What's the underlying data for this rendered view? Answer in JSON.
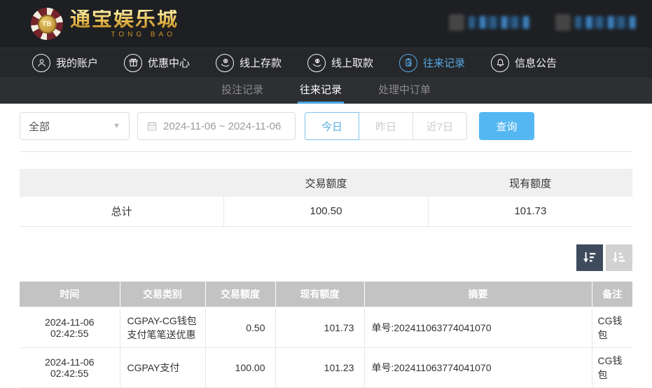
{
  "brand": {
    "logo_monogram": "TB",
    "name_cn": "通宝娱乐城",
    "name_en": "TONG BAO"
  },
  "nav": {
    "items": [
      {
        "label": "我的账户",
        "icon": "user-icon",
        "active": false
      },
      {
        "label": "优惠中心",
        "icon": "gift-icon",
        "active": false
      },
      {
        "label": "线上存款",
        "icon": "deposit-hand-coin-icon",
        "active": false
      },
      {
        "label": "线上取款",
        "icon": "withdraw-hand-dollar-icon",
        "active": false
      },
      {
        "label": "往来记录",
        "icon": "clipboard-clock-icon",
        "active": true
      },
      {
        "label": "信息公告",
        "icon": "bell-icon",
        "active": false
      }
    ]
  },
  "subtabs": [
    {
      "label": "投注记录",
      "active": false
    },
    {
      "label": "往来记录",
      "active": true
    },
    {
      "label": "处理中订单",
      "active": false
    }
  ],
  "filters": {
    "type_select_value": "全部",
    "date_range_value": "2024-11-06 ~ 2024-11-06",
    "quick_buttons": [
      {
        "label": "今日",
        "active": true
      },
      {
        "label": "昨日",
        "active": false
      },
      {
        "label": "近7日",
        "active": false
      }
    ],
    "search_label": "查询"
  },
  "summary": {
    "headers": {
      "label": "",
      "transaction_amount": "交易额度",
      "current_balance": "现有额度"
    },
    "total_row": {
      "label": "总计",
      "transaction_amount": "100.50",
      "current_balance": "101.73"
    }
  },
  "sort": {
    "descending_icon": "sort-descending-icon",
    "ascending_icon": "sort-ascending-icon"
  },
  "records_table": {
    "headers": {
      "time": "时间",
      "type": "交易类别",
      "amount": "交易额度",
      "balance": "现有额度",
      "summary": "摘要",
      "note": "备注"
    },
    "rows": [
      {
        "time": "2024-11-06 02:42:55",
        "type": "CGPAY-CG钱包支付笔笔送优惠",
        "amount": "0.50",
        "balance": "101.73",
        "summary": "单号:202411063774041070",
        "note": "CG钱包"
      },
      {
        "time": "2024-11-06 02:42:55",
        "type": "CGPAY支付",
        "amount": "100.00",
        "balance": "101.23",
        "summary": "单号:202411063774041070",
        "note": "CG钱包"
      }
    ]
  },
  "colors": {
    "accent_blue": "#54a9e6",
    "tab_underline_blue": "#4aa3e0",
    "search_button_blue": "#55b7f2",
    "header_bg": "#1e1f22",
    "nav_bg": "#26272a",
    "subtab_bg": "#2e2f33",
    "table_header_gray": "#c3c3c3",
    "sort_active_bg": "#3d4b5c",
    "sort_inactive_bg": "#d2d2d2",
    "brand_gold": "#e4b94d"
  }
}
